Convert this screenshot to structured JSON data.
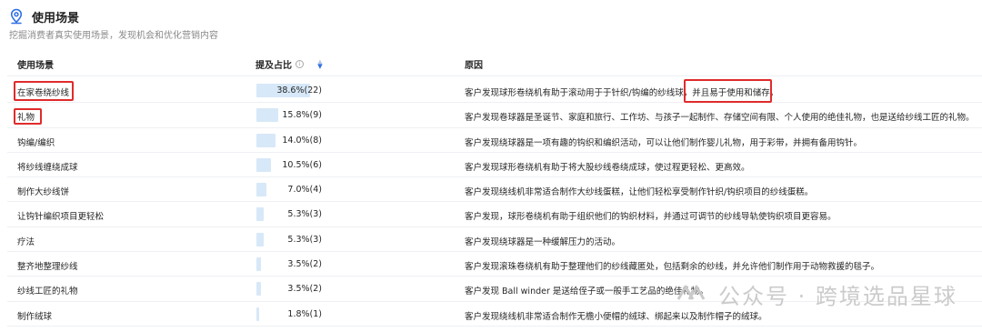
{
  "header": {
    "title": "使用场景",
    "subtitle": "挖掘消费者真实使用场景，发现机会和优化营销内容"
  },
  "table": {
    "columns": {
      "scenario": "使用场景",
      "share": "提及占比",
      "reason": "原因"
    },
    "rows": [
      {
        "name": "在家卷绕纱线",
        "pct": "38.6%(22)",
        "share": 38.6,
        "reason_a": "客户发现球形卷绕机有助于滚动用于于针织/钩编的纱线球，",
        "reason_b": "并且易于使用和储存。"
      },
      {
        "name": "礼物",
        "pct": "15.8%(9)",
        "share": 15.8,
        "reason_a": "客户发现卷球器是圣诞节、家庭和旅行、工作坊、与孩子一起制作、存储空间有限、个人使用的绝佳礼物，也是送给纱线工匠的礼物。",
        "reason_b": ""
      },
      {
        "name": "钩编/编织",
        "pct": "14.0%(8)",
        "share": 14.0,
        "reason_a": "客户发现绕球器是一项有趣的钩织和编织活动，可以让他们制作婴儿礼物，用于彩带，并拥有备用钩针。",
        "reason_b": ""
      },
      {
        "name": "将纱线缠绕成球",
        "pct": "10.5%(6)",
        "share": 10.5,
        "reason_a": "客户发现球形卷绕机有助于将大股纱线卷绕成球，使过程更轻松、更高效。",
        "reason_b": ""
      },
      {
        "name": "制作大纱线饼",
        "pct": "7.0%(4)",
        "share": 7.0,
        "reason_a": "客户发现绕线机非常适合制作大纱线蛋糕，让他们轻松享受制作针织/钩织项目的纱线蛋糕。",
        "reason_b": ""
      },
      {
        "name": "让钩针编织项目更轻松",
        "pct": "5.3%(3)",
        "share": 5.3,
        "reason_a": "客户发现，球形卷绕机有助于组织他们的钩织材料，并通过可调节的纱线导轨使钩织项目更容易。",
        "reason_b": ""
      },
      {
        "name": "疗法",
        "pct": "5.3%(3)",
        "share": 5.3,
        "reason_a": "客户发现绕球器是一种缓解压力的活动。",
        "reason_b": ""
      },
      {
        "name": "整齐地整理纱线",
        "pct": "3.5%(2)",
        "share": 3.5,
        "reason_a": "客户发现滚珠卷绕机有助于整理他们的纱线藏匿处，包括剩余的纱线，并允许他们制作用于动物救援的毯子。",
        "reason_b": ""
      },
      {
        "name": "纱线工匠的礼物",
        "pct": "3.5%(2)",
        "share": 3.5,
        "reason_a": "客户发现 Ball winder 是送给侄子或一般手工艺品的绝佳礼物。",
        "reason_b": ""
      },
      {
        "name": "制作绒球",
        "pct": "1.8%(1)",
        "share": 1.8,
        "reason_a": "客户发现绕线机非常适合制作无檐小便帽的绒球、绑起来以及制作帽子的绒球。",
        "reason_b": ""
      }
    ]
  },
  "watermark": {
    "text": "公众号 · 跨境选品星球"
  },
  "colors": {
    "bar": "#d7e8f8",
    "highlight_box": "#e02b2b",
    "accent": "#2f6fe4"
  }
}
